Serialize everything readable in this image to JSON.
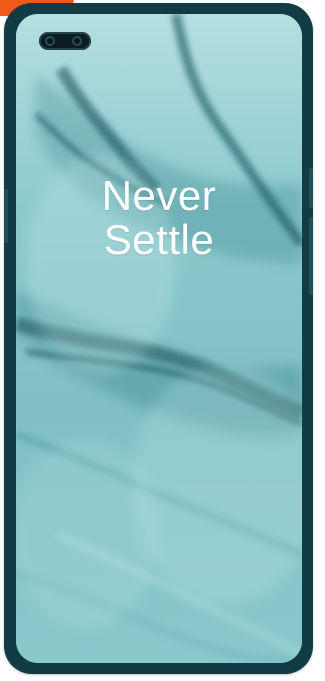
{
  "screen": {
    "slogan_line_1": "Never",
    "slogan_line_2": "Settle"
  },
  "colors": {
    "frame": "#113c46",
    "badge": "#f05a1a",
    "wallpaper_base": "#7fc1c6"
  },
  "icons": {
    "camera": "dual-punch-hole-camera-icon"
  }
}
